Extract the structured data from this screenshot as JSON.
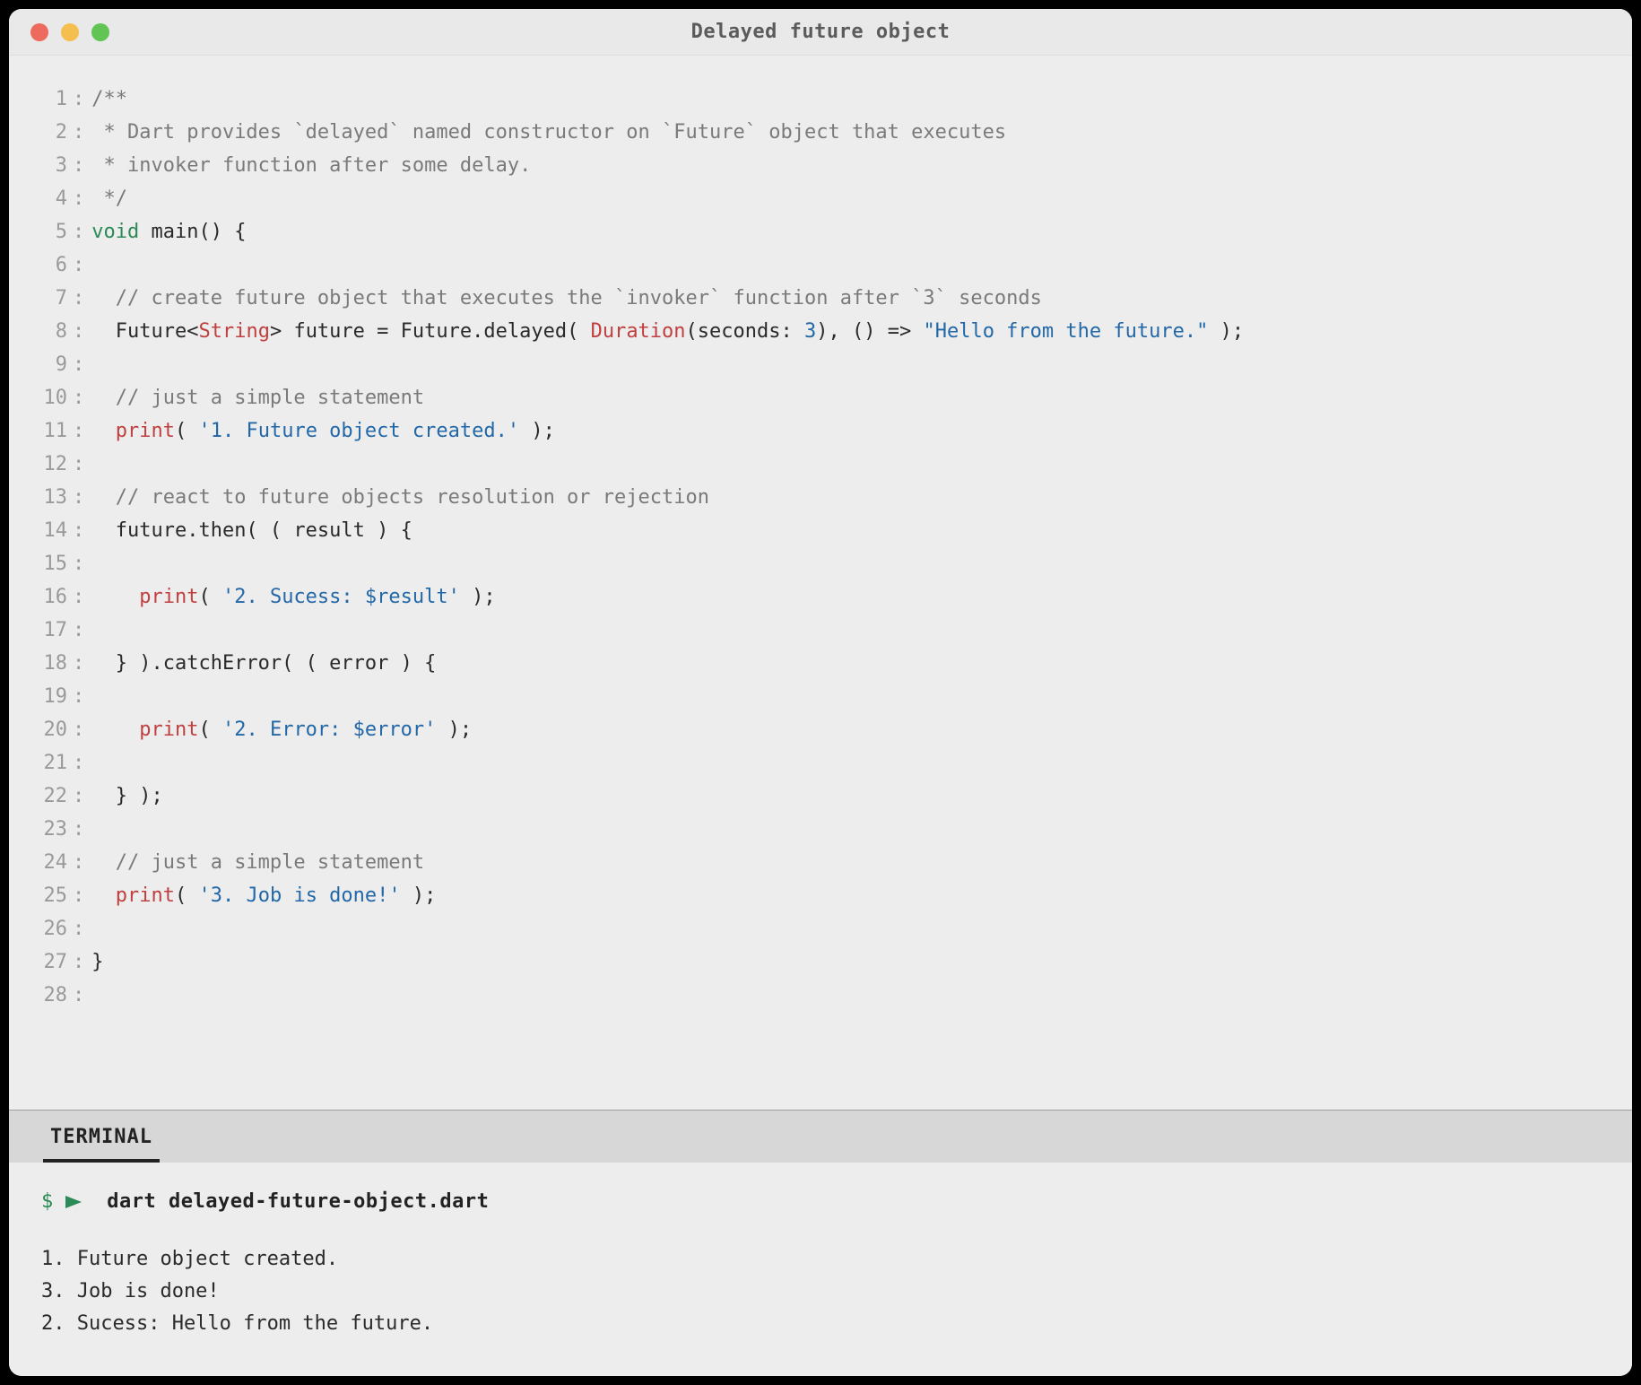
{
  "window": {
    "title": "Delayed future object"
  },
  "code": {
    "lines": [
      {
        "n": 1,
        "tokens": [
          {
            "c": "c-comment",
            "t": "/**"
          }
        ]
      },
      {
        "n": 2,
        "tokens": [
          {
            "c": "c-comment",
            "t": " * Dart provides `delayed` named constructor on `Future` object that executes"
          }
        ]
      },
      {
        "n": 3,
        "tokens": [
          {
            "c": "c-comment",
            "t": " * invoker function after some delay."
          }
        ]
      },
      {
        "n": 4,
        "tokens": [
          {
            "c": "c-comment",
            "t": " */"
          }
        ]
      },
      {
        "n": 5,
        "tokens": [
          {
            "c": "c-keyword",
            "t": "void"
          },
          {
            "c": "c-plain",
            "t": " main() {"
          }
        ]
      },
      {
        "n": 6,
        "tokens": []
      },
      {
        "n": 7,
        "tokens": [
          {
            "c": "c-comment",
            "t": "  // create future object that executes the `invoker` function after `3` seconds"
          }
        ]
      },
      {
        "n": 8,
        "tokens": [
          {
            "c": "c-plain",
            "t": "  Future<"
          },
          {
            "c": "c-type",
            "t": "String"
          },
          {
            "c": "c-plain",
            "t": "> future = Future.delayed( "
          },
          {
            "c": "c-type",
            "t": "Duration"
          },
          {
            "c": "c-plain",
            "t": "(seconds: "
          },
          {
            "c": "c-number",
            "t": "3"
          },
          {
            "c": "c-plain",
            "t": "), () => "
          },
          {
            "c": "c-string",
            "t": "\"Hello from the future.\""
          },
          {
            "c": "c-plain",
            "t": " );"
          }
        ]
      },
      {
        "n": 9,
        "tokens": []
      },
      {
        "n": 10,
        "tokens": [
          {
            "c": "c-comment",
            "t": "  // just a simple statement"
          }
        ]
      },
      {
        "n": 11,
        "tokens": [
          {
            "c": "c-plain",
            "t": "  "
          },
          {
            "c": "c-func",
            "t": "print"
          },
          {
            "c": "c-plain",
            "t": "( "
          },
          {
            "c": "c-string",
            "t": "'1. Future object created.'"
          },
          {
            "c": "c-plain",
            "t": " );"
          }
        ]
      },
      {
        "n": 12,
        "tokens": []
      },
      {
        "n": 13,
        "tokens": [
          {
            "c": "c-comment",
            "t": "  // react to future objects resolution or rejection"
          }
        ]
      },
      {
        "n": 14,
        "tokens": [
          {
            "c": "c-plain",
            "t": "  future.then( ( result ) {"
          }
        ]
      },
      {
        "n": 15,
        "tokens": []
      },
      {
        "n": 16,
        "tokens": [
          {
            "c": "c-plain",
            "t": "    "
          },
          {
            "c": "c-func",
            "t": "print"
          },
          {
            "c": "c-plain",
            "t": "( "
          },
          {
            "c": "c-string",
            "t": "'2. Sucess: $result'"
          },
          {
            "c": "c-plain",
            "t": " );"
          }
        ]
      },
      {
        "n": 17,
        "tokens": []
      },
      {
        "n": 18,
        "tokens": [
          {
            "c": "c-plain",
            "t": "  } ).catchError( ( error ) {"
          }
        ]
      },
      {
        "n": 19,
        "tokens": []
      },
      {
        "n": 20,
        "tokens": [
          {
            "c": "c-plain",
            "t": "    "
          },
          {
            "c": "c-func",
            "t": "print"
          },
          {
            "c": "c-plain",
            "t": "( "
          },
          {
            "c": "c-string",
            "t": "'2. Error: $error'"
          },
          {
            "c": "c-plain",
            "t": " );"
          }
        ]
      },
      {
        "n": 21,
        "tokens": []
      },
      {
        "n": 22,
        "tokens": [
          {
            "c": "c-plain",
            "t": "  } );"
          }
        ]
      },
      {
        "n": 23,
        "tokens": []
      },
      {
        "n": 24,
        "tokens": [
          {
            "c": "c-comment",
            "t": "  // just a simple statement"
          }
        ]
      },
      {
        "n": 25,
        "tokens": [
          {
            "c": "c-plain",
            "t": "  "
          },
          {
            "c": "c-func",
            "t": "print"
          },
          {
            "c": "c-plain",
            "t": "( "
          },
          {
            "c": "c-string",
            "t": "'3. Job is done!'"
          },
          {
            "c": "c-plain",
            "t": " );"
          }
        ]
      },
      {
        "n": 26,
        "tokens": []
      },
      {
        "n": 27,
        "tokens": [
          {
            "c": "c-plain",
            "t": "}"
          }
        ]
      },
      {
        "n": 28,
        "tokens": []
      }
    ]
  },
  "terminal": {
    "tab": "TERMINAL",
    "prompt": "$",
    "command": "dart delayed-future-object.dart",
    "output": [
      "1. Future object created.",
      "3. Job is done!",
      "2. Sucess: Hello from the future."
    ]
  }
}
